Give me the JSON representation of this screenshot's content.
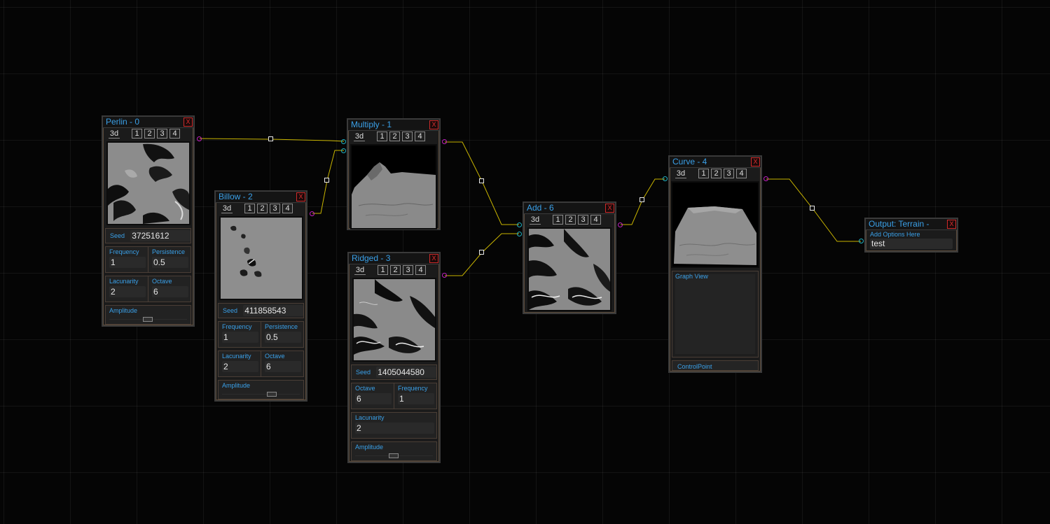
{
  "nodes": {
    "perlin": {
      "title": "Perlin - 0",
      "close": "X",
      "tabs": [
        "3d",
        "1",
        "2",
        "3",
        "4"
      ],
      "seed_label": "Seed",
      "seed": "37251612",
      "frequency_label": "Frequency",
      "frequency": "1",
      "persistence_label": "Persistence",
      "persistence": "0.5",
      "lacunarity_label": "Lacunarity",
      "lacunarity": "2",
      "octave_label": "Octave",
      "octave": "6",
      "amplitude_label": "Amplitude"
    },
    "billow": {
      "title": "Billow - 2",
      "close": "X",
      "tabs": [
        "3d",
        "1",
        "2",
        "3",
        "4"
      ],
      "seed_label": "Seed",
      "seed": "411858543",
      "frequency_label": "Frequency",
      "frequency": "1",
      "persistence_label": "Persistence",
      "persistence": "0.5",
      "lacunarity_label": "Lacunarity",
      "lacunarity": "2",
      "octave_label": "Octave",
      "octave": "6",
      "amplitude_label": "Amplitude"
    },
    "multiply": {
      "title": "Multiply - 1",
      "close": "X",
      "tabs": [
        "3d",
        "1",
        "2",
        "3",
        "4"
      ]
    },
    "ridged": {
      "title": "Ridged - 3",
      "close": "X",
      "tabs": [
        "3d",
        "1",
        "2",
        "3",
        "4"
      ],
      "seed_label": "Seed",
      "seed": "1405044580",
      "octave_label": "Octave",
      "octave": "6",
      "frequency_label": "Frequency",
      "frequency": "1",
      "lacunarity_label": "Lacunarity",
      "lacunarity": "2",
      "amplitude_label": "Amplitude"
    },
    "add": {
      "title": "Add - 6",
      "close": "X",
      "tabs": [
        "3d",
        "1",
        "2",
        "3",
        "4"
      ]
    },
    "curve": {
      "title": "Curve - 4",
      "close": "X",
      "tabs": [
        "3d",
        "1",
        "2",
        "3",
        "4"
      ],
      "graph_label": "Graph View",
      "control_point_label": "ControlPoint"
    },
    "output": {
      "title": "Output: Terrain -",
      "close": "X",
      "options_label": "Add Options Here",
      "option_value": "test"
    }
  },
  "colors": {
    "title_text": "#3aa0e8",
    "wire": "#c8b400",
    "output_port": "#c020c0",
    "input_port": "#20b0c0",
    "close": "#e03030"
  }
}
